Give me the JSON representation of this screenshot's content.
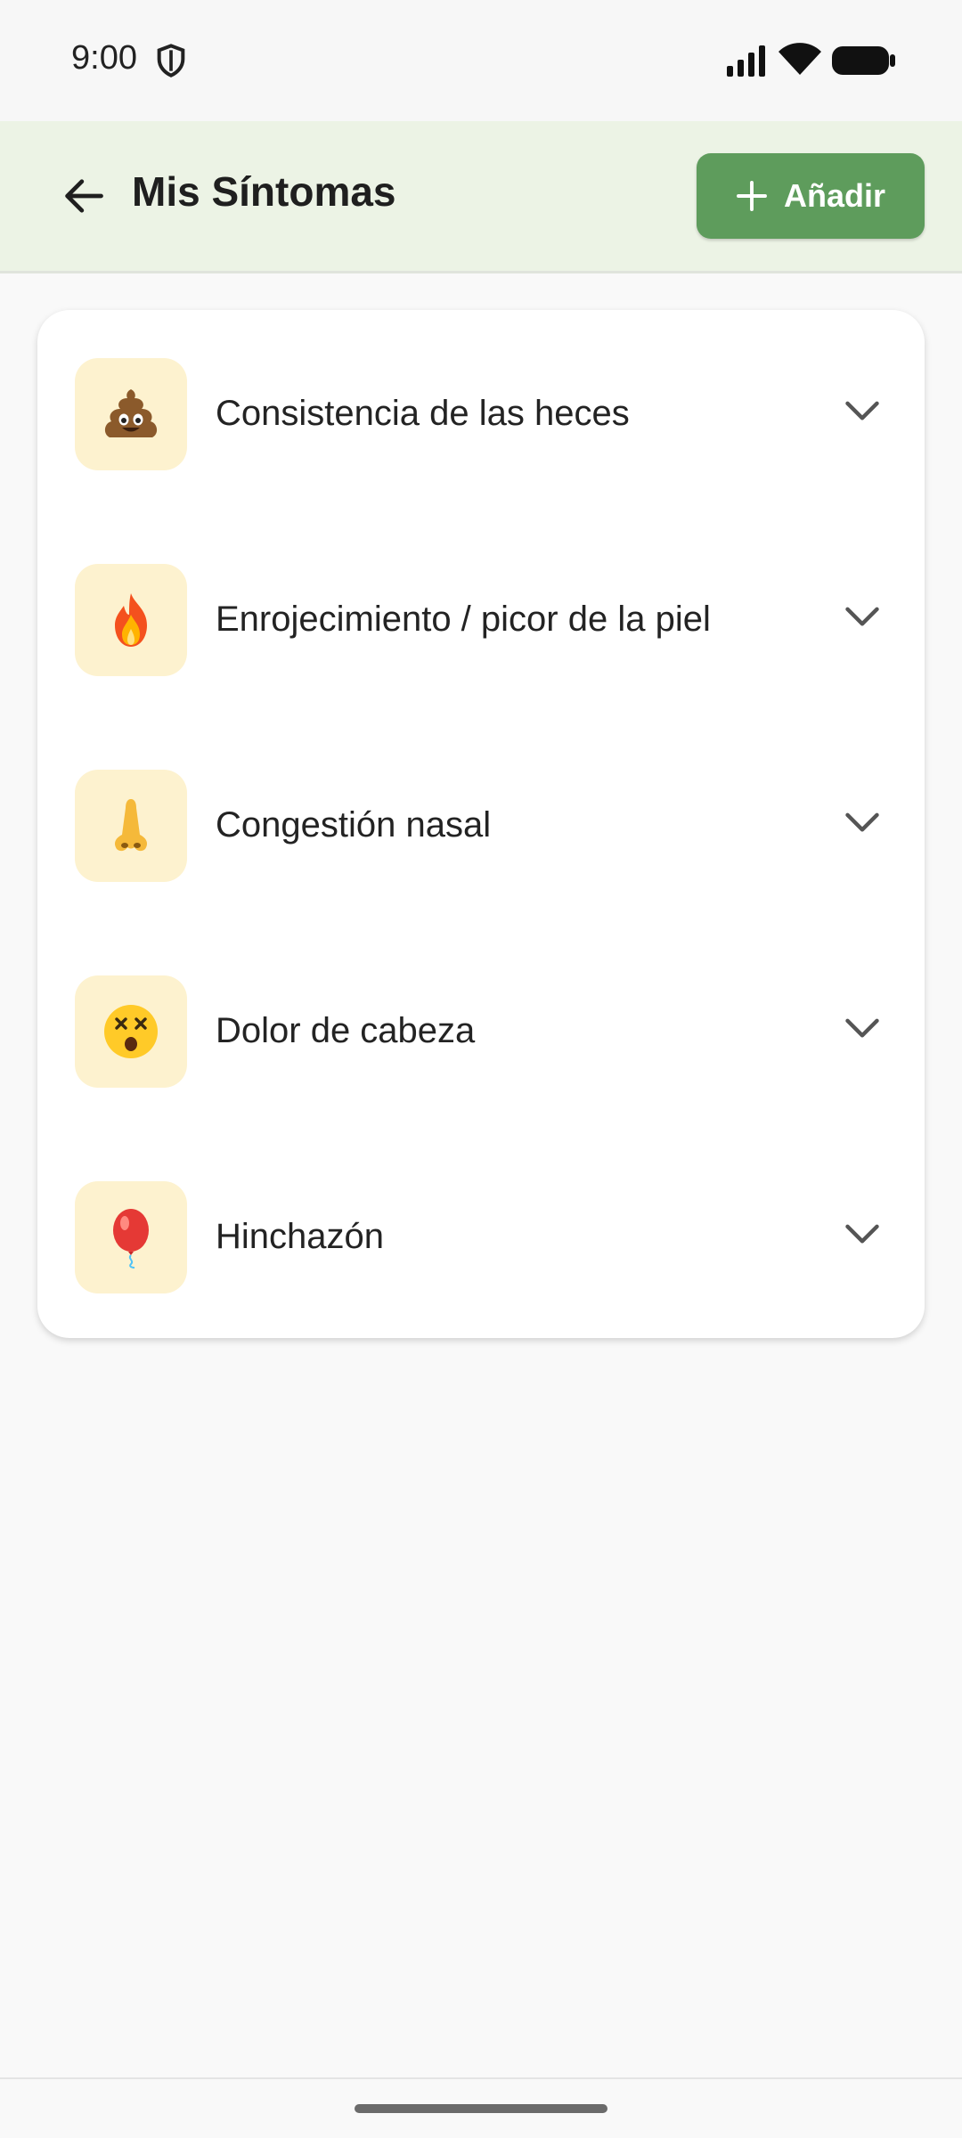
{
  "status_bar": {
    "time": "9:00",
    "icons": [
      "shield-icon",
      "signal-icon",
      "wifi-icon",
      "battery-icon"
    ]
  },
  "app_bar": {
    "title": "Mis Síntomas",
    "add_label": "Añadir",
    "colors": {
      "background": "#ecf3e5",
      "button": "#5e9c5c"
    }
  },
  "symptoms": [
    {
      "label": "Consistencia de las heces",
      "icon": "poop-emoji-icon"
    },
    {
      "label": "Enrojecimiento / picor de la piel",
      "icon": "fire-emoji-icon"
    },
    {
      "label": "Congestión nasal",
      "icon": "nose-emoji-icon"
    },
    {
      "label": "Dolor de cabeza",
      "icon": "dizzy-face-emoji-icon"
    },
    {
      "label": "Hinchazón",
      "icon": "balloon-emoji-icon"
    }
  ]
}
